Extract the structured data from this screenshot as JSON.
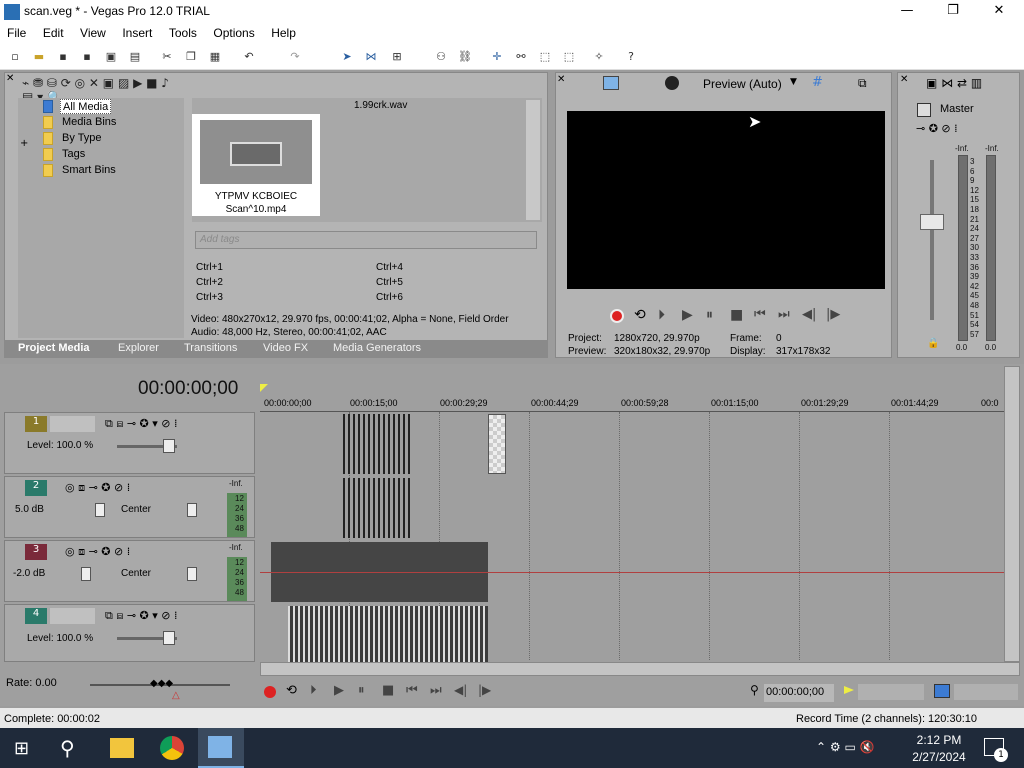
{
  "window": {
    "title": "scan.veg * - Vegas Pro 12.0 TRIAL",
    "minimize": "—",
    "restore": "❐",
    "close": "✕"
  },
  "menu": [
    "File",
    "Edit",
    "View",
    "Insert",
    "Tools",
    "Options",
    "Help"
  ],
  "explorer": {
    "items": [
      "All Media",
      "Media Bins",
      "By Type",
      "Tags",
      "Smart Bins"
    ],
    "expand": "+"
  },
  "media": {
    "file_top": "1.99crk.wav",
    "clip_name": "YTPMV KCBOIEC\nScan^10.mp4",
    "tags_placeholder": "Add tags",
    "shortcuts": [
      "Ctrl+1",
      "Ctrl+4",
      "Ctrl+2",
      "Ctrl+5",
      "Ctrl+3",
      "Ctrl+6"
    ],
    "info_video": "Video: 480x270x12, 29.970 fps, 00:00:41;02, Alpha = None, Field Order",
    "info_audio": "Audio: 48,000 Hz, Stereo, 00:00:41;02, AAC"
  },
  "tabs": [
    "Project Media",
    "Explorer",
    "Transitions",
    "Video FX",
    "Media Generators"
  ],
  "preview": {
    "mode": "Preview (Auto)",
    "project_label": "Project:",
    "project": "1280x720, 29.970p",
    "frame_label": "Frame:",
    "frame": "0",
    "preview_label": "Preview:",
    "preview_val": "320x180x32, 29.970p",
    "display_label": "Display:",
    "display_val": "317x178x32"
  },
  "master": {
    "label": "Master",
    "left": "-Inf.",
    "right": "-Inf.",
    "scale": [
      "3",
      "6",
      "9",
      "12",
      "15",
      "18",
      "21",
      "24",
      "27",
      "30",
      "33",
      "36",
      "39",
      "42",
      "45",
      "48",
      "51",
      "54",
      "57"
    ],
    "bottom_left": "0.0",
    "bottom_right": "0.0"
  },
  "timeline": {
    "timecode": "00:00:00;00",
    "ruler": [
      "00:00:00;00",
      "00:00:15;00",
      "00:00:29;29",
      "00:00:44;29",
      "00:00:59;28",
      "00:01:15;00",
      "00:01:29;29",
      "00:01:44;29",
      "00:0"
    ]
  },
  "tracks": [
    {
      "num": "1",
      "label": "Level: 100.0 %",
      "type": "video"
    },
    {
      "num": "2",
      "label": "5.0 dB",
      "pan": "Center",
      "type": "audio",
      "meter": [
        "-Inf.",
        "12",
        "24",
        "36",
        "48"
      ]
    },
    {
      "num": "3",
      "label": "-2.0 dB",
      "pan": "Center",
      "type": "audio",
      "meter": [
        "-Inf.",
        "12",
        "24",
        "36",
        "48"
      ]
    },
    {
      "num": "4",
      "label": "Level: 100.0 %",
      "type": "video"
    }
  ],
  "rate": "Rate: 0.00",
  "transport_time": "00:00:00;00",
  "status": {
    "left": "Complete: 00:00:02",
    "right": "Record Time (2 channels): 120:30:10"
  },
  "clock": {
    "time": "2:12 PM",
    "date": "2/27/2024"
  },
  "notif_count": "1"
}
